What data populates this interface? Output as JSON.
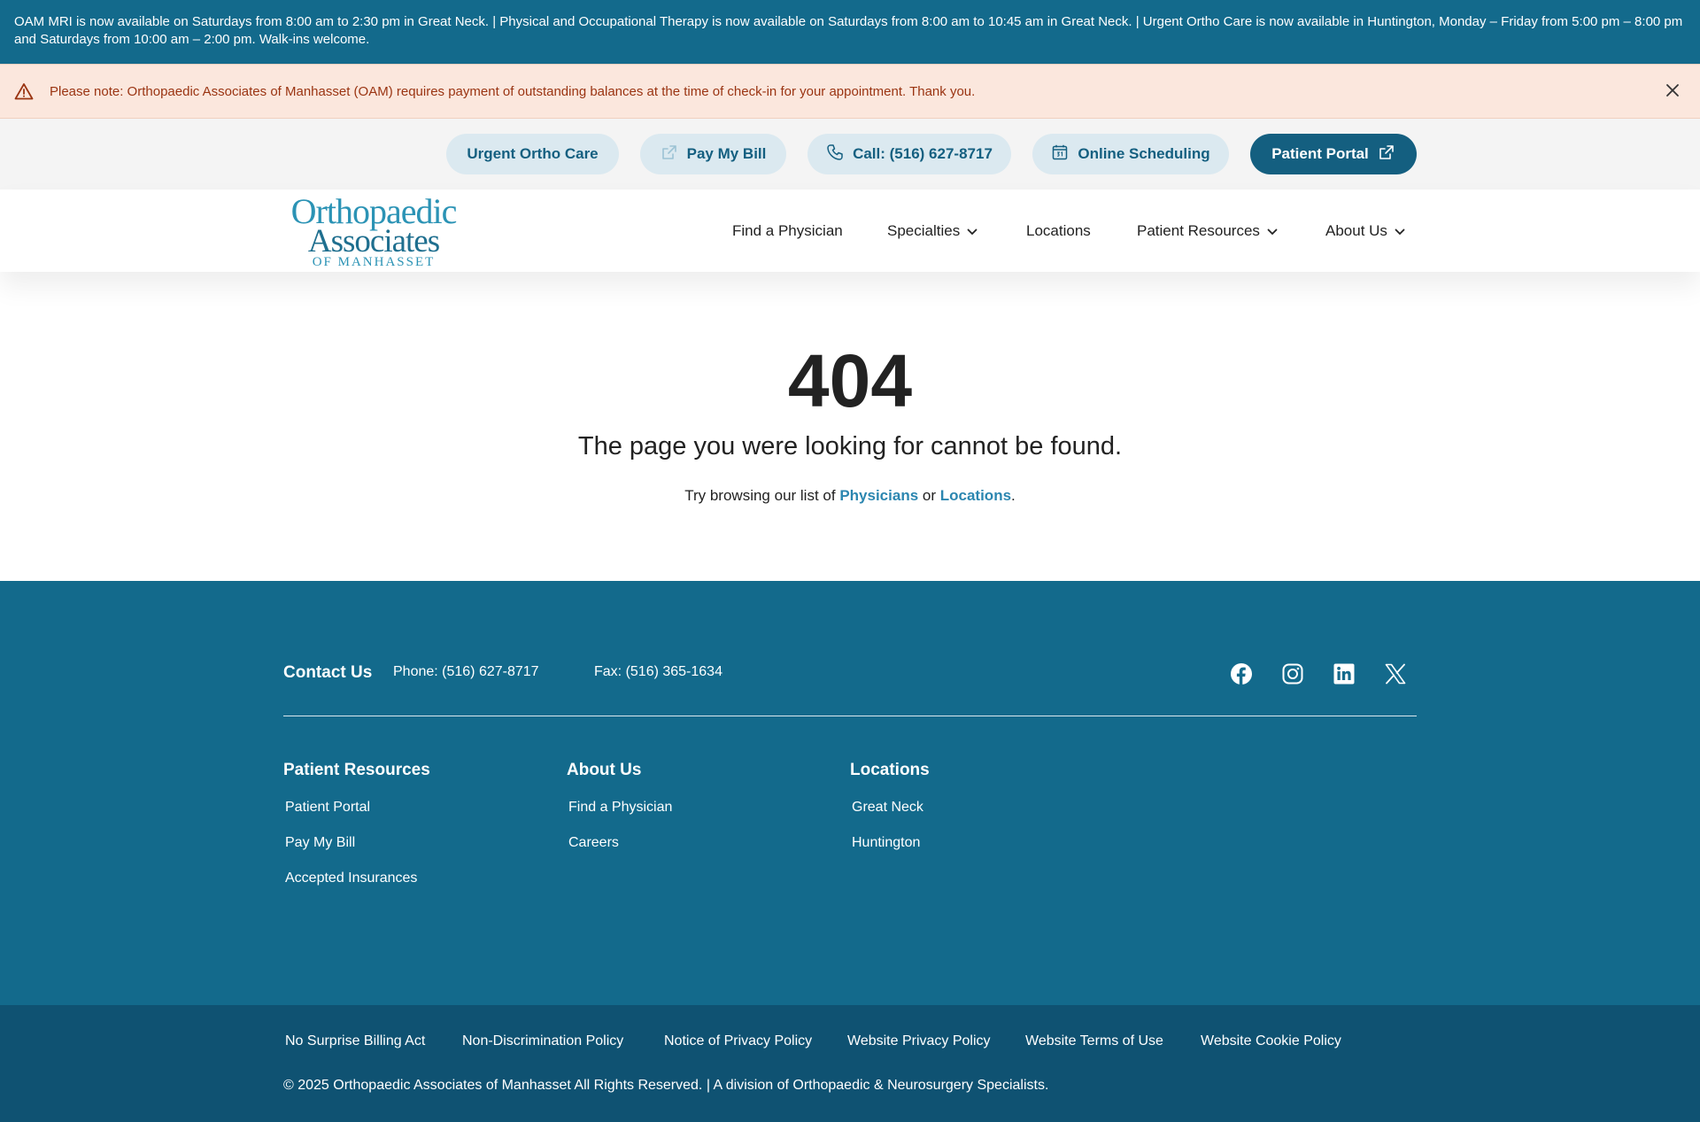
{
  "announcement": {
    "text": "OAM MRI is now available on Saturdays from 8:00 am to 2:30 pm in Great Neck. | Physical and Occupational Therapy is now available on Saturdays from 8:00 am to 10:45 am in Great Neck. | Urgent Ortho Care is now available in Huntington, Monday – Friday from 5:00 pm – 8:00 pm and Saturdays from 10:00 am – 2:00 pm. Walk-ins welcome."
  },
  "notice": {
    "text": "Please note: Orthopaedic Associates of Manhasset (OAM) requires payment of outstanding balances at the time of check-in for your appointment. Thank you.",
    "icon": "warning-triangle-icon",
    "close_icon": "close-icon"
  },
  "utility": {
    "urgent": "Urgent Ortho Care",
    "pay": "Pay My Bill",
    "call": "Call: (516) 627-8717",
    "schedule": "Online Scheduling",
    "portal": "Patient Portal"
  },
  "logo": {
    "line1": "Orthopaedic",
    "line2": "Associates",
    "line3": "OF MANHASSET"
  },
  "nav": {
    "find": "Find a Physician",
    "specialties": "Specialties",
    "locations": "Locations",
    "resources": "Patient Resources",
    "about": "About Us"
  },
  "error": {
    "code": "404",
    "message": "The page you were looking for cannot be found.",
    "hint_prefix": "Try browsing our list of",
    "physicians_link": "Physicians",
    "or": "or",
    "locations_link": "Locations",
    "period": "."
  },
  "footer": {
    "contact_title": "Contact Us",
    "phone": "Phone: (516) 627-8717",
    "fax": "Fax: (516) 365-1634",
    "social": [
      "facebook-icon",
      "instagram-icon",
      "linkedin-icon",
      "x-icon"
    ],
    "columns": [
      {
        "heading": "Patient Resources",
        "links": [
          "Patient Portal",
          "Pay My Bill",
          "Accepted Insurances"
        ]
      },
      {
        "heading": "About Us",
        "links": [
          "Find a Physician",
          "Careers"
        ]
      },
      {
        "heading": "Locations",
        "links": [
          "Great Neck",
          "Huntington"
        ]
      }
    ],
    "legal_links": [
      "No Surprise Billing Act",
      "Non-Discrimination Policy",
      "Notice of Privacy Policy",
      "Website Privacy Policy",
      "Website Terms of Use",
      "Website Cookie Policy"
    ],
    "copyright": "© 2025 Orthopaedic Associates of Manhasset All Rights Reserved. | A division of Orthopaedic & Neurosurgery Specialists."
  },
  "colors": {
    "brand": "#136a8c",
    "brand_dark": "#0f5272",
    "pill": "#dbe9f0",
    "notice_bg": "#fbe7dd",
    "notice_text": "#9a3412",
    "link": "#2b86b0"
  }
}
